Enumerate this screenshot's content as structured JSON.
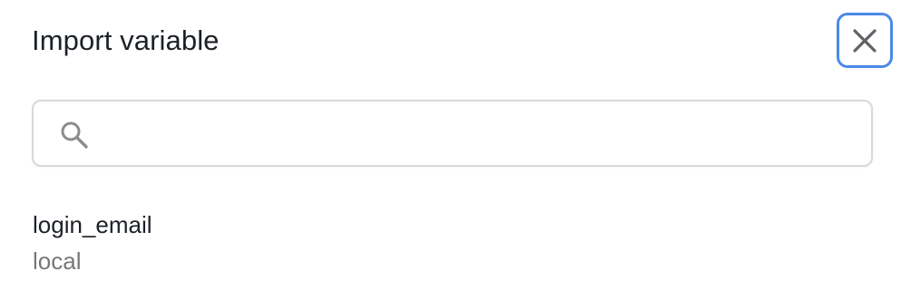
{
  "dialog": {
    "title": "Import variable",
    "close_icon": "close-icon"
  },
  "search": {
    "value": "",
    "placeholder": "",
    "icon": "search-icon"
  },
  "variables": [
    {
      "name": "login_email",
      "scope": "local"
    }
  ],
  "colors": {
    "title_text": "#1c2127",
    "focus_ring": "#4a8ae8",
    "secondary_text": "#777777",
    "border": "#d9d9d9"
  }
}
